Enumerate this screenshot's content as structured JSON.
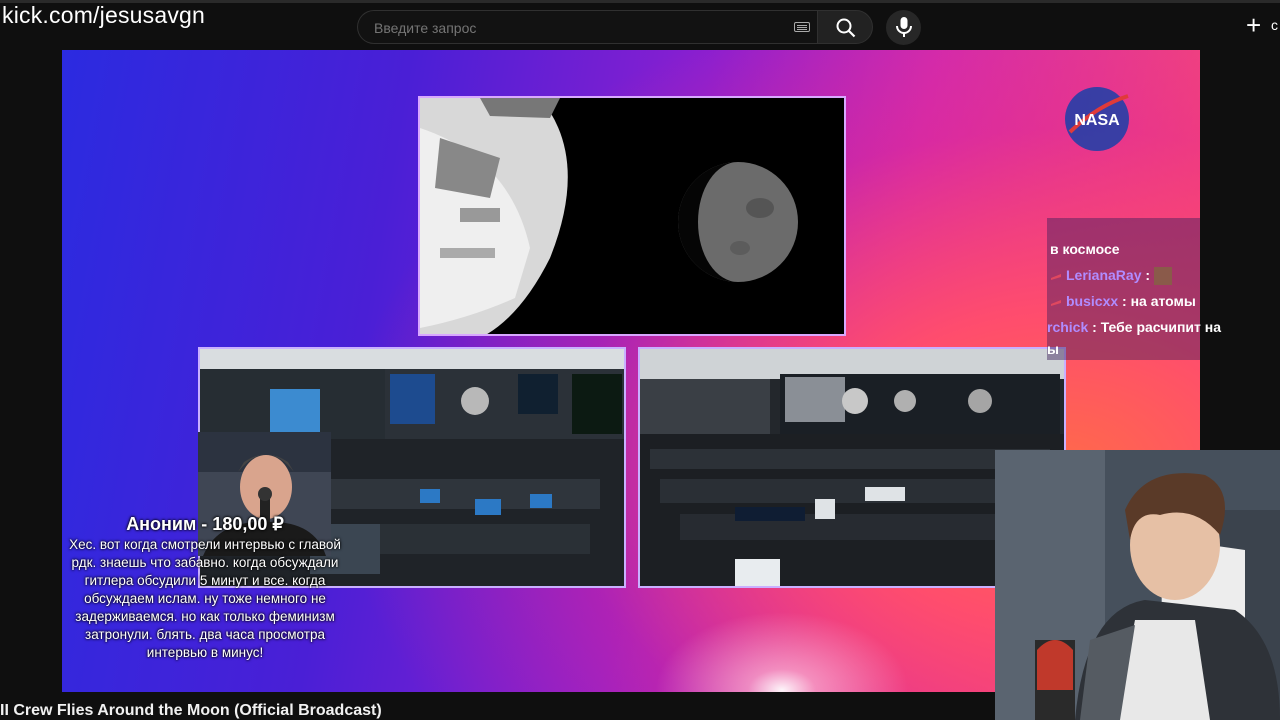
{
  "browser": {
    "url": "kick.com/jesusavgn"
  },
  "search": {
    "placeholder": "Введите запрос"
  },
  "header": {
    "create_label": "с"
  },
  "chat": {
    "messages": [
      {
        "nick": "",
        "text": "в космосе"
      },
      {
        "nick": "LerianaRay",
        "text": ":"
      },
      {
        "nick": "busicxx",
        "text": ": на атомы"
      },
      {
        "nick": "rchick",
        "text": ": Тебе расчипит на"
      },
      {
        "nick": "",
        "text": "ы"
      }
    ],
    "nick_color": "#b08cff",
    "badge_color": "#e0485f"
  },
  "donation": {
    "title": "Аноним - 180,00 ₽",
    "text": "Хес. вот когда смотрели интервью с главой рдк. знаешь что забавно. когда обсуждали гитлера обсудили 5 минут и все. когда обсуждаем ислам. ну тоже немного не задерживаемся. но как только феминизм затронули. блять. два часа просмотра интервью в минус!"
  },
  "video": {
    "title": "II Crew Flies Around the Moon (Official Broadcast)",
    "logo_text": "NASA"
  },
  "icons": {
    "keyboard": "keyboard-icon",
    "search": "search-icon",
    "mic": "mic-icon",
    "create": "plus-icon"
  }
}
